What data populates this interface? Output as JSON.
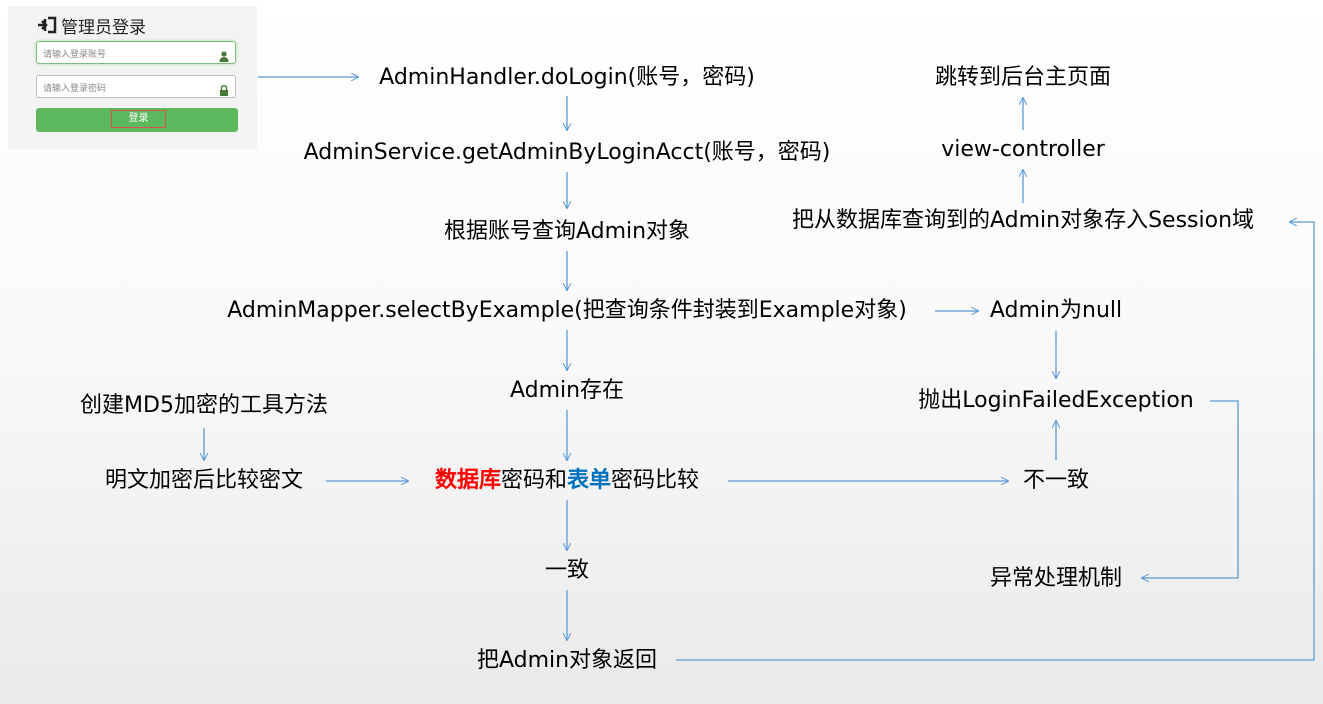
{
  "login": {
    "title": "管理员登录",
    "account_placeholder": "请输入登录账号",
    "password_placeholder": "请输入登录密码",
    "button_label": "登录",
    "title_icon": "sign-in-icon",
    "account_icon": "user-icon",
    "password_icon": "lock-icon",
    "button_color": "#5cb85c"
  },
  "flow": {
    "do_login": "AdminHandler.doLogin(账号，密码)",
    "get_admin": "AdminService.getAdminByLoginAcct(账号，密码)",
    "query_admin": "根据账号查询Admin对象",
    "select_by_example": "AdminMapper.selectByExample(把查询条件封装到Example对象)",
    "admin_null": "Admin为null",
    "admin_exists": "Admin存在",
    "throw_exception": "抛出LoginFailedException",
    "create_md5": "创建MD5加密的工具方法",
    "encrypt_compare": "明文加密后比较密文",
    "compare": {
      "part1": "数据库",
      "part2": "密码和",
      "part3": "表单",
      "part4": "密码比较"
    },
    "mismatch": "不一致",
    "match": "一致",
    "exception_handling": "异常处理机制",
    "return_admin": "把Admin对象返回",
    "store_session": "把从数据库查询到的Admin对象存入Session域",
    "view_controller": "view-controller",
    "jump_main": "跳转到后台主页面"
  },
  "colors": {
    "arrow": "#5b9bd5",
    "database_highlight": "#ff0000",
    "form_highlight": "#0070c0"
  }
}
